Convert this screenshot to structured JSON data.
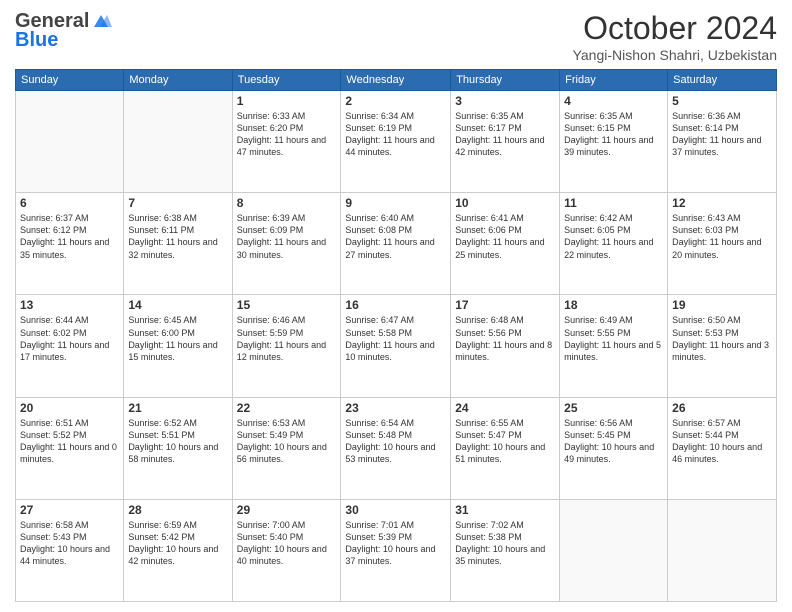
{
  "header": {
    "logo_general": "General",
    "logo_blue": "Blue",
    "month_title": "October 2024",
    "location": "Yangi-Nishon Shahri, Uzbekistan"
  },
  "days_of_week": [
    "Sunday",
    "Monday",
    "Tuesday",
    "Wednesday",
    "Thursday",
    "Friday",
    "Saturday"
  ],
  "weeks": [
    [
      {
        "day": "",
        "info": ""
      },
      {
        "day": "",
        "info": ""
      },
      {
        "day": "1",
        "info": "Sunrise: 6:33 AM\nSunset: 6:20 PM\nDaylight: 11 hours and 47 minutes."
      },
      {
        "day": "2",
        "info": "Sunrise: 6:34 AM\nSunset: 6:19 PM\nDaylight: 11 hours and 44 minutes."
      },
      {
        "day": "3",
        "info": "Sunrise: 6:35 AM\nSunset: 6:17 PM\nDaylight: 11 hours and 42 minutes."
      },
      {
        "day": "4",
        "info": "Sunrise: 6:35 AM\nSunset: 6:15 PM\nDaylight: 11 hours and 39 minutes."
      },
      {
        "day": "5",
        "info": "Sunrise: 6:36 AM\nSunset: 6:14 PM\nDaylight: 11 hours and 37 minutes."
      }
    ],
    [
      {
        "day": "6",
        "info": "Sunrise: 6:37 AM\nSunset: 6:12 PM\nDaylight: 11 hours and 35 minutes."
      },
      {
        "day": "7",
        "info": "Sunrise: 6:38 AM\nSunset: 6:11 PM\nDaylight: 11 hours and 32 minutes."
      },
      {
        "day": "8",
        "info": "Sunrise: 6:39 AM\nSunset: 6:09 PM\nDaylight: 11 hours and 30 minutes."
      },
      {
        "day": "9",
        "info": "Sunrise: 6:40 AM\nSunset: 6:08 PM\nDaylight: 11 hours and 27 minutes."
      },
      {
        "day": "10",
        "info": "Sunrise: 6:41 AM\nSunset: 6:06 PM\nDaylight: 11 hours and 25 minutes."
      },
      {
        "day": "11",
        "info": "Sunrise: 6:42 AM\nSunset: 6:05 PM\nDaylight: 11 hours and 22 minutes."
      },
      {
        "day": "12",
        "info": "Sunrise: 6:43 AM\nSunset: 6:03 PM\nDaylight: 11 hours and 20 minutes."
      }
    ],
    [
      {
        "day": "13",
        "info": "Sunrise: 6:44 AM\nSunset: 6:02 PM\nDaylight: 11 hours and 17 minutes."
      },
      {
        "day": "14",
        "info": "Sunrise: 6:45 AM\nSunset: 6:00 PM\nDaylight: 11 hours and 15 minutes."
      },
      {
        "day": "15",
        "info": "Sunrise: 6:46 AM\nSunset: 5:59 PM\nDaylight: 11 hours and 12 minutes."
      },
      {
        "day": "16",
        "info": "Sunrise: 6:47 AM\nSunset: 5:58 PM\nDaylight: 11 hours and 10 minutes."
      },
      {
        "day": "17",
        "info": "Sunrise: 6:48 AM\nSunset: 5:56 PM\nDaylight: 11 hours and 8 minutes."
      },
      {
        "day": "18",
        "info": "Sunrise: 6:49 AM\nSunset: 5:55 PM\nDaylight: 11 hours and 5 minutes."
      },
      {
        "day": "19",
        "info": "Sunrise: 6:50 AM\nSunset: 5:53 PM\nDaylight: 11 hours and 3 minutes."
      }
    ],
    [
      {
        "day": "20",
        "info": "Sunrise: 6:51 AM\nSunset: 5:52 PM\nDaylight: 11 hours and 0 minutes."
      },
      {
        "day": "21",
        "info": "Sunrise: 6:52 AM\nSunset: 5:51 PM\nDaylight: 10 hours and 58 minutes."
      },
      {
        "day": "22",
        "info": "Sunrise: 6:53 AM\nSunset: 5:49 PM\nDaylight: 10 hours and 56 minutes."
      },
      {
        "day": "23",
        "info": "Sunrise: 6:54 AM\nSunset: 5:48 PM\nDaylight: 10 hours and 53 minutes."
      },
      {
        "day": "24",
        "info": "Sunrise: 6:55 AM\nSunset: 5:47 PM\nDaylight: 10 hours and 51 minutes."
      },
      {
        "day": "25",
        "info": "Sunrise: 6:56 AM\nSunset: 5:45 PM\nDaylight: 10 hours and 49 minutes."
      },
      {
        "day": "26",
        "info": "Sunrise: 6:57 AM\nSunset: 5:44 PM\nDaylight: 10 hours and 46 minutes."
      }
    ],
    [
      {
        "day": "27",
        "info": "Sunrise: 6:58 AM\nSunset: 5:43 PM\nDaylight: 10 hours and 44 minutes."
      },
      {
        "day": "28",
        "info": "Sunrise: 6:59 AM\nSunset: 5:42 PM\nDaylight: 10 hours and 42 minutes."
      },
      {
        "day": "29",
        "info": "Sunrise: 7:00 AM\nSunset: 5:40 PM\nDaylight: 10 hours and 40 minutes."
      },
      {
        "day": "30",
        "info": "Sunrise: 7:01 AM\nSunset: 5:39 PM\nDaylight: 10 hours and 37 minutes."
      },
      {
        "day": "31",
        "info": "Sunrise: 7:02 AM\nSunset: 5:38 PM\nDaylight: 10 hours and 35 minutes."
      },
      {
        "day": "",
        "info": ""
      },
      {
        "day": "",
        "info": ""
      }
    ]
  ]
}
